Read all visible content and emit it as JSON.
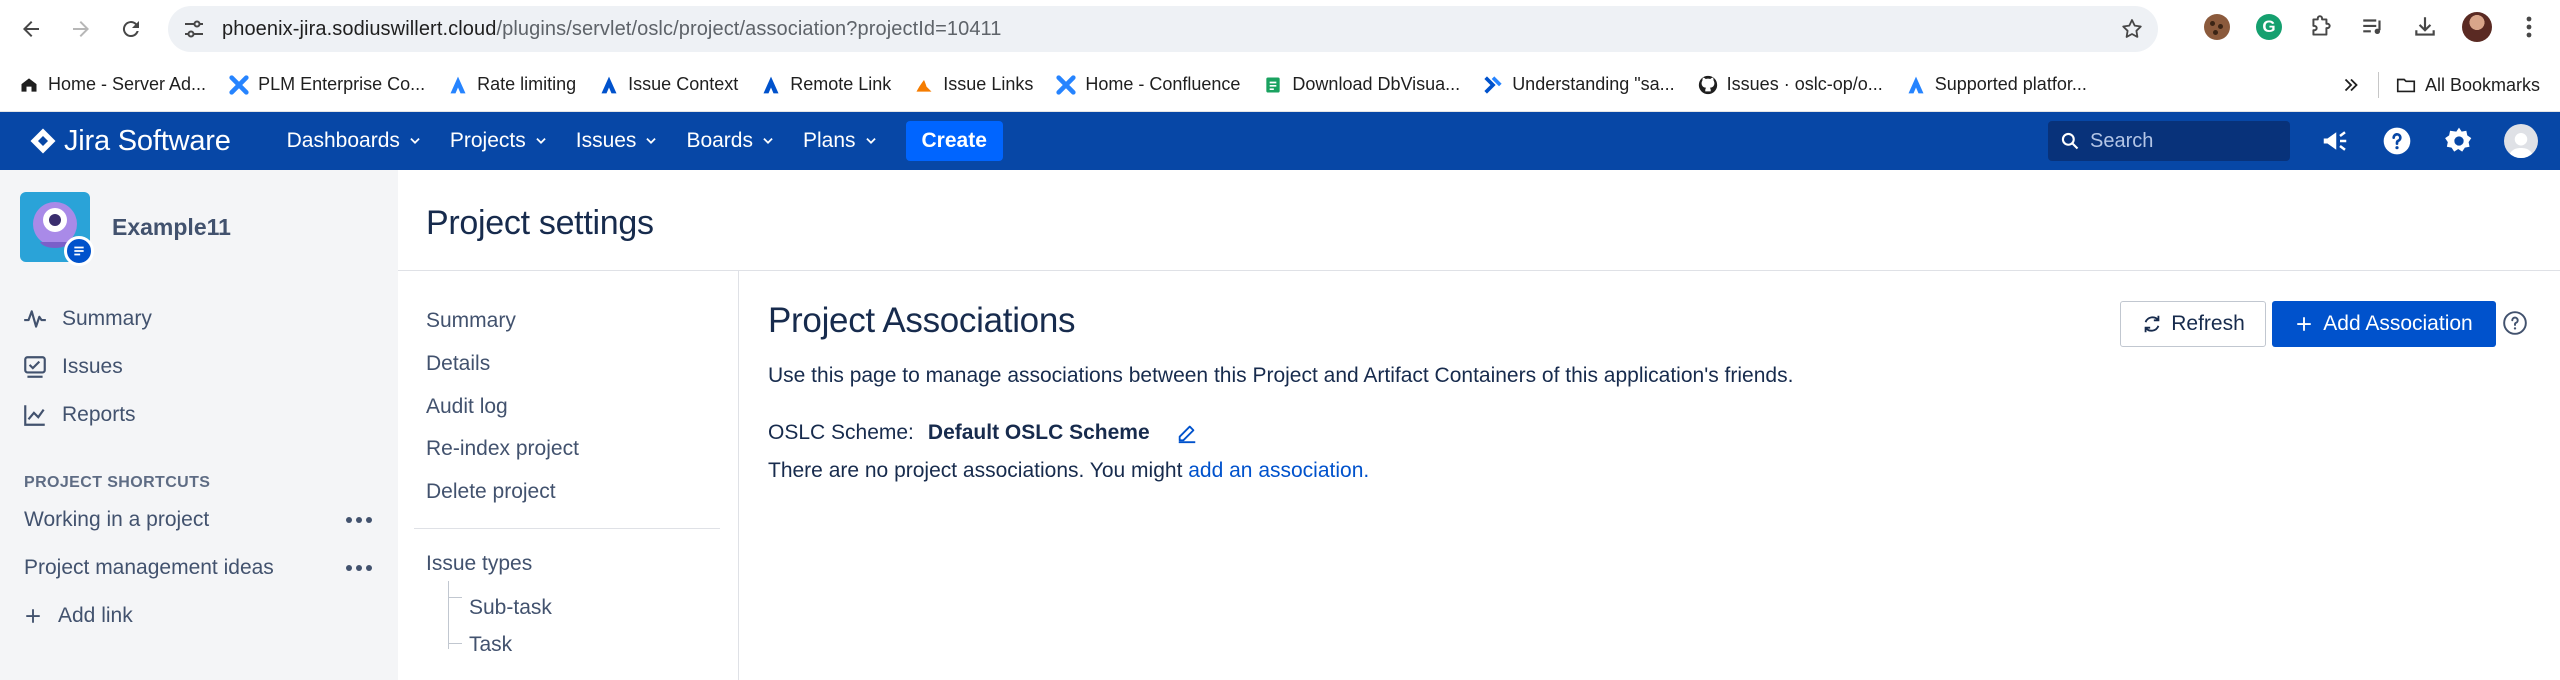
{
  "browser": {
    "url_host": "phoenix-jira.sodiuswillert.cloud",
    "url_path": "/plugins/servlet/oslc/project/association?projectId=10411"
  },
  "bookmarks": {
    "items": [
      {
        "label": "Home - Server Ad..."
      },
      {
        "label": "PLM Enterprise Co..."
      },
      {
        "label": "Rate limiting"
      },
      {
        "label": "Issue Context"
      },
      {
        "label": "Remote Link"
      },
      {
        "label": "Issue Links"
      },
      {
        "label": "Home - Confluence"
      },
      {
        "label": "Download DbVisua..."
      },
      {
        "label": "Understanding \"sa..."
      },
      {
        "label": "Issues · oslc-op/o..."
      },
      {
        "label": "Supported platfor..."
      }
    ],
    "all_bookmarks": "All Bookmarks"
  },
  "jira_nav": {
    "product": "Jira Software",
    "menus": [
      "Dashboards",
      "Projects",
      "Issues",
      "Boards",
      "Plans"
    ],
    "create_label": "Create",
    "search_placeholder": "Search"
  },
  "sidebar": {
    "project_name": "Example11",
    "items": [
      {
        "label": "Summary"
      },
      {
        "label": "Issues"
      },
      {
        "label": "Reports"
      }
    ],
    "shortcuts_title": "PROJECT SHORTCUTS",
    "shortcuts": [
      {
        "label": "Working in a project"
      },
      {
        "label": "Project management ideas"
      }
    ],
    "add_link": "Add link"
  },
  "page": {
    "title": "Project settings"
  },
  "settings_nav": {
    "items": [
      "Summary",
      "Details",
      "Audit log",
      "Re-index project",
      "Delete project"
    ],
    "issue_types_label": "Issue types",
    "issue_types": [
      "Sub-task",
      "Task"
    ]
  },
  "content": {
    "title": "Project Associations",
    "description": "Use this page to manage associations between this Project and Artifact Containers of this application's friends.",
    "scheme_label": "OSLC Scheme:",
    "scheme_value": "Default OSLC Scheme",
    "empty_text": "There are no project associations. You might ",
    "empty_link": "add an association.",
    "refresh_label": "Refresh",
    "add_label": "Add Association"
  }
}
